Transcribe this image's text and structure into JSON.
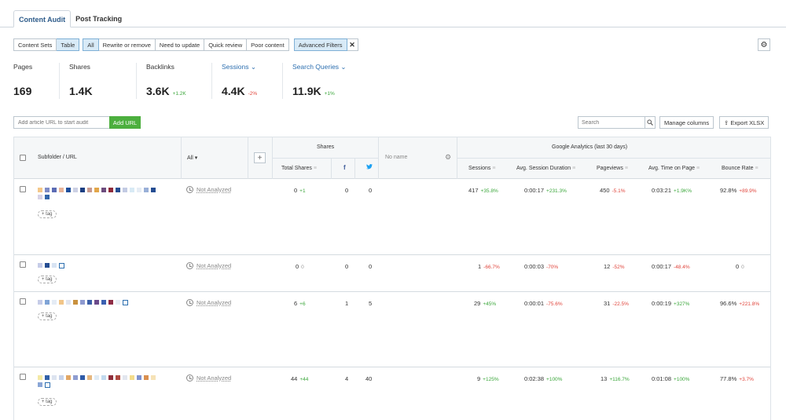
{
  "tabs": [
    {
      "label": "Content Audit",
      "active": true
    },
    {
      "label": "Post Tracking",
      "active": false
    }
  ],
  "toolbar": {
    "view_buttons": [
      "Content Sets",
      "Table"
    ],
    "filter_buttons": [
      "All",
      "Rewrite or remove",
      "Need to update",
      "Quick review",
      "Poor content"
    ],
    "advanced_filters": "Advanced Filters",
    "close": "✕",
    "settings_icon": "⚙"
  },
  "metrics": [
    {
      "label": "Pages",
      "value": "169",
      "delta": "",
      "dir": "",
      "link": false
    },
    {
      "label": "Shares",
      "value": "1.4K",
      "delta": "",
      "dir": "",
      "link": false
    },
    {
      "label": "Backlinks",
      "value": "3.6K",
      "delta": "+1.2K",
      "dir": "pos",
      "link": false
    },
    {
      "label": "Sessions ⌄",
      "value": "4.4K",
      "delta": "-2%",
      "dir": "neg",
      "link": true
    },
    {
      "label": "Search Queries ⌄",
      "value": "11.9K",
      "delta": "+1%",
      "dir": "pos",
      "link": true
    }
  ],
  "add_url": {
    "placeholder": "Add article URL to start audit",
    "button": "Add URL"
  },
  "search": {
    "placeholder": "Search",
    "icon": "🔍"
  },
  "manage_columns": "Manage columns",
  "export": "⇪ Export XLSX",
  "table": {
    "headers": {
      "subfolder": "Subfolder / URL",
      "all": "All ▾",
      "plus": "+",
      "shares_group": "Shares",
      "total_shares": "Total Shares",
      "facebook": "f",
      "twitter": "🐦",
      "no_name": "No name",
      "ga_group": "Google Analytics (last 30 days)",
      "sessions": "Sessions",
      "avg_session": "Avg. Session Duration",
      "pageviews": "Pageviews",
      "avg_time": "Avg. Time on Page",
      "bounce": "Bounce Rate"
    },
    "status": "Not Analyzed",
    "tag": "+ tag",
    "rows": [
      {
        "shares": "0",
        "shares_d": "+1",
        "shares_dir": "pos",
        "fb": "0",
        "tw": "0",
        "sessions": "417",
        "sessions_d": "+35.8%",
        "sessions_dir": "pos",
        "avg_session": "0:00:17",
        "avg_session_d": "+231.3%",
        "avg_session_dir": "pos",
        "pageviews": "450",
        "pageviews_d": "-5.1%",
        "pageviews_dir": "neg",
        "avg_time": "0:03:21",
        "avg_time_d": "+1.9K%",
        "avg_time_dir": "pos",
        "bounce": "92.8%",
        "bounce_d": "+89.9%",
        "bounce_dir": "neg"
      },
      {
        "shares": "0",
        "shares_d": "0",
        "shares_dir": "zero",
        "fb": "0",
        "tw": "0",
        "sessions": "1",
        "sessions_d": "-66.7%",
        "sessions_dir": "neg",
        "avg_session": "0:00:03",
        "avg_session_d": "-70%",
        "avg_session_dir": "neg",
        "pageviews": "12",
        "pageviews_d": "-52%",
        "pageviews_dir": "neg",
        "avg_time": "0:00:17",
        "avg_time_d": "-48.4%",
        "avg_time_dir": "neg",
        "bounce": "0",
        "bounce_d": "0",
        "bounce_dir": "zero"
      },
      {
        "shares": "6",
        "shares_d": "+6",
        "shares_dir": "pos",
        "fb": "1",
        "tw": "5",
        "sessions": "29",
        "sessions_d": "+45%",
        "sessions_dir": "pos",
        "avg_session": "0:00:01",
        "avg_session_d": "-75.6%",
        "avg_session_dir": "neg",
        "pageviews": "31",
        "pageviews_d": "-22.5%",
        "pageviews_dir": "neg",
        "avg_time": "0:00:19",
        "avg_time_d": "+327%",
        "avg_time_dir": "pos",
        "bounce": "96.6%",
        "bounce_d": "+221.8%",
        "bounce_dir": "neg"
      },
      {
        "shares": "44",
        "shares_d": "+44",
        "shares_dir": "pos",
        "fb": "4",
        "tw": "40",
        "sessions": "9",
        "sessions_d": "+125%",
        "sessions_dir": "pos",
        "avg_session": "0:02:38",
        "avg_session_d": "+100%",
        "avg_session_dir": "pos",
        "pageviews": "13",
        "pageviews_d": "+116.7%",
        "pageviews_dir": "pos",
        "avg_time": "0:01:08",
        "avg_time_d": "+100%",
        "avg_time_dir": "pos",
        "bounce": "77.8%",
        "bounce_d": "+3.7%",
        "bounce_dir": "neg"
      }
    ]
  }
}
